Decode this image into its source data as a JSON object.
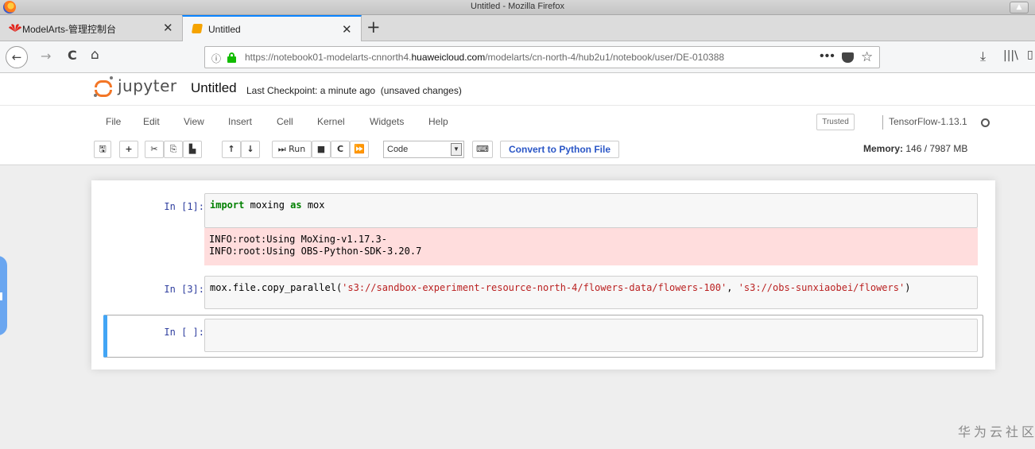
{
  "window": {
    "title": "Untitled - Mozilla Firefox"
  },
  "tabs": [
    {
      "label": "ModelArts-管理控制台",
      "icon": "huawei-icon"
    },
    {
      "label": "Untitled",
      "icon": "notebook-icon"
    }
  ],
  "address": {
    "url_prefix": "https://notebook01-modelarts-cnnorth4.",
    "url_domain": "huaweicloud.com",
    "url_suffix": "/modelarts/cn-north-4/hub2u1/notebook/user/DE-010388"
  },
  "jupyter": {
    "brand": "jupyter",
    "notebook_name": "Untitled",
    "checkpoint": "Last Checkpoint: a minute ago",
    "unsaved": "(unsaved changes)",
    "menu": [
      "File",
      "Edit",
      "View",
      "Insert",
      "Cell",
      "Kernel",
      "Widgets",
      "Help"
    ],
    "trusted": "Trusted",
    "kernel_name": "TensorFlow-1.13.1",
    "toolbar": {
      "run_label": "Run",
      "cell_type": "Code",
      "convert_label": "Convert to Python File"
    },
    "memory_label": "Memory:",
    "memory_value": "146 / 7987 MB"
  },
  "cells": [
    {
      "prompt": "In [1]:",
      "code_kw1": "import",
      "code_mid": " moxing ",
      "code_kw2": "as",
      "code_end": " mox",
      "output": [
        "INFO:root:Using MoXing-v1.17.3-",
        "INFO:root:Using OBS-Python-SDK-3.20.7"
      ]
    },
    {
      "prompt": "In [3]:",
      "code_a": "mox.file.copy_parallel(",
      "str1": "'s3://sandbox-experiment-resource-north-4/flowers-data/flowers-100'",
      "code_b": ", ",
      "str2": "'s3://obs-sunxiaobei/flowers'",
      "code_c": ")"
    },
    {
      "prompt": "In [ ]:"
    }
  ],
  "watermark": "华为云社区"
}
